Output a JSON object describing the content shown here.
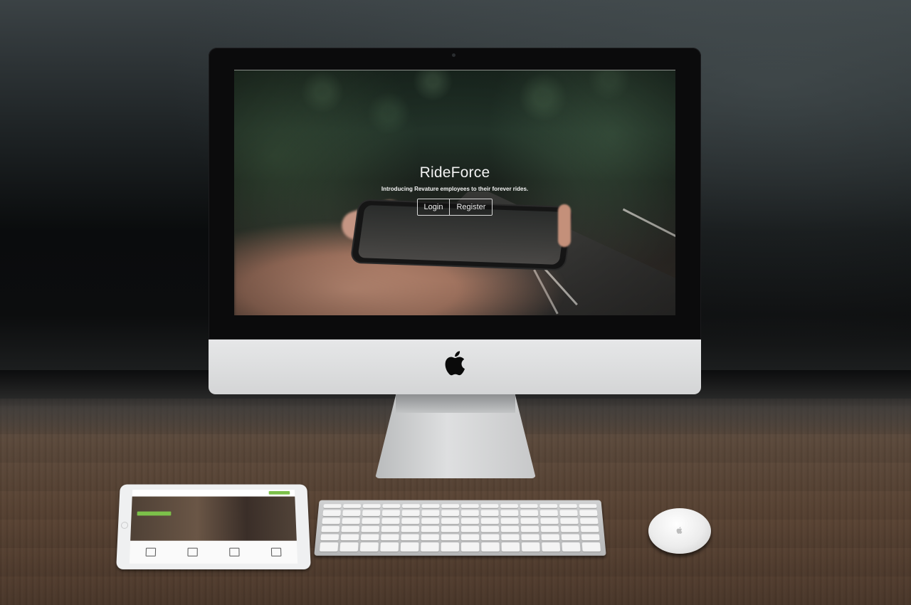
{
  "site": {
    "brand_title": "RideForce",
    "tagline": "Introducing Revature employees to their forever rides.",
    "buttons": [
      {
        "label": "Login"
      },
      {
        "label": "Register"
      }
    ]
  },
  "icons": {
    "apple_logo": "apple-logo-icon",
    "mouse_logo": "apple-logo-icon"
  },
  "colors": {
    "hero_text": "#f2f2f2",
    "button_border": "#d9d9d9",
    "ipad_accent": "#7cc14a"
  }
}
